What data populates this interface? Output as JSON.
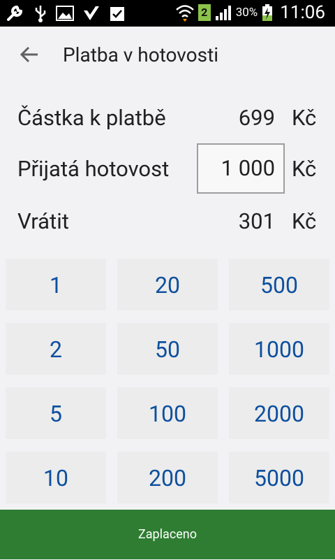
{
  "status_bar": {
    "sim_number": "2",
    "battery_percent": "30%",
    "time": "11:06",
    "left_icons": [
      "wrench-icon",
      "usb-icon",
      "image-icon",
      "check-icon",
      "clipboard-icon"
    ]
  },
  "app_bar": {
    "title": "Platba v hotovosti"
  },
  "summary": {
    "amount_due_label": "Částka k platbě",
    "amount_due_value": "699",
    "cash_received_label": "Přijatá hotovost",
    "cash_received_value": "1 000",
    "change_label": "Vrátit",
    "change_value": "301",
    "currency": "Kč"
  },
  "keypad": {
    "keys": [
      [
        "1",
        "20",
        "500"
      ],
      [
        "2",
        "50",
        "1000"
      ],
      [
        "5",
        "100",
        "2000"
      ],
      [
        "10",
        "200",
        "5000"
      ]
    ]
  },
  "pay_button": {
    "label": "Zaplaceno"
  }
}
